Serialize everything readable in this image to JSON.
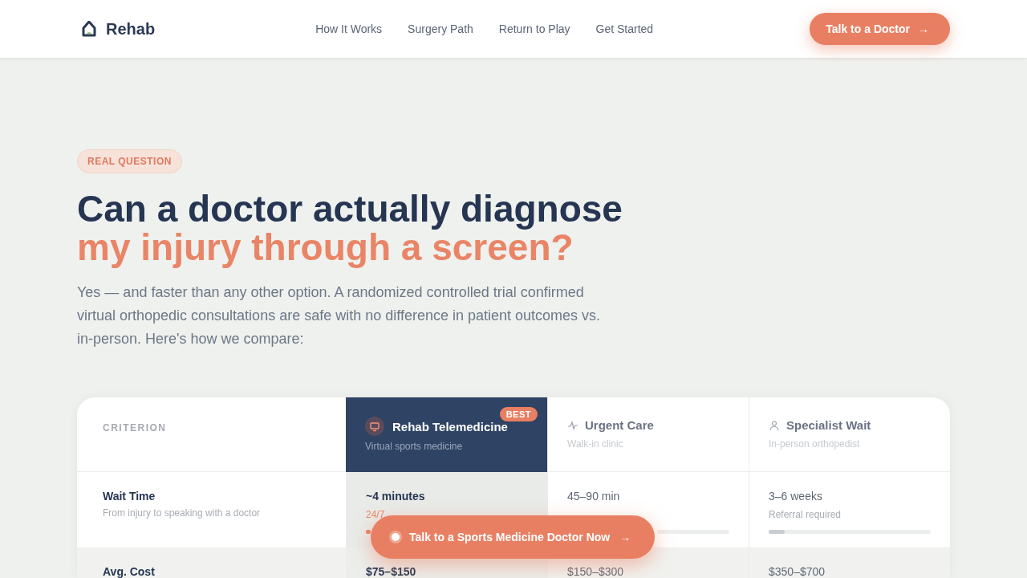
{
  "header": {
    "brand": "Rehab",
    "nav": [
      "How It Works",
      "Surgery Path",
      "Return to Play",
      "Get Started"
    ],
    "cta": "Talk to a Doctor",
    "cta_arrow": "→"
  },
  "hero": {
    "eyebrow": "REAL QUESTION",
    "title_line1": "Can a doctor actually diagnose",
    "title_line2": "my injury through a screen?",
    "lead": "Yes — and faster than any other option. A randomized controlled trial confirmed virtual orthopedic consultations are safe with no difference in patient outcomes vs. in-person. Here's how we compare:"
  },
  "table": {
    "criterion_heading": "CRITERION",
    "columns": [
      {
        "kind": "featured",
        "name": "Rehab Telemedicine",
        "sub": "Virtual sports medicine",
        "badge": "BEST"
      },
      {
        "kind": "plain",
        "name": "Urgent Care",
        "sub": "Walk-in clinic"
      },
      {
        "kind": "plain",
        "name": "Specialist Wait",
        "sub": "In-person orthopedist"
      }
    ],
    "rows": [
      {
        "label": "Wait Time",
        "hint": "From injury to speaking with a doctor",
        "cells": [
          {
            "kind": "stub",
            "value": "~4 minutes",
            "note": "24/7"
          },
          {
            "kind": "stub",
            "value": "45–90 min"
          },
          {
            "kind": "bar",
            "value": "3–6 weeks",
            "note": "Referral required",
            "level": 0.1
          }
        ]
      },
      {
        "label": "Avg. Cost",
        "cells": [
          {
            "value": "$75–$150"
          },
          {
            "value": "$150–$300"
          },
          {
            "value": "$350–$700"
          }
        ]
      }
    ]
  },
  "floating_cta": {
    "label": "Talk to a Sports Medicine Doctor Now",
    "arrow": "→"
  }
}
